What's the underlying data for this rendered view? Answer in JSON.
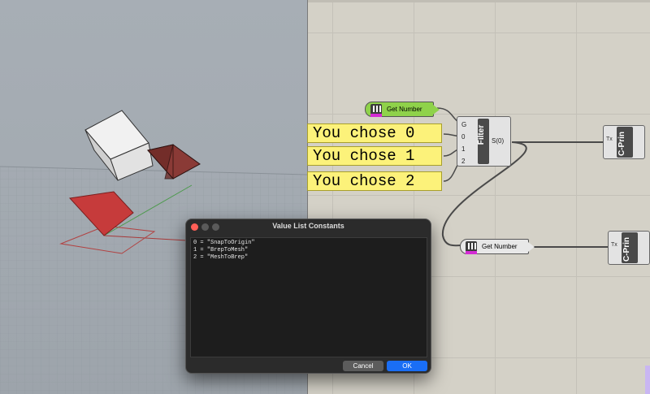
{
  "panels": [
    {
      "text": "You chose 0"
    },
    {
      "text": "You chose 1"
    },
    {
      "text": "You chose 2"
    }
  ],
  "get_number_top": {
    "label": "Get Number"
  },
  "get_number_bottom": {
    "label": "Get Number"
  },
  "filter": {
    "title": "Filter",
    "inputs": [
      "G",
      "0",
      "1",
      "2"
    ],
    "output": "S(0)"
  },
  "cprint_top": {
    "label": "C-Prin",
    "input": "Tx"
  },
  "cprint_bottom": {
    "label": "C-Prin",
    "input": "Tx"
  },
  "dialog": {
    "title": "Value List Constants",
    "lines": [
      "0 = \"SnapToOrigin\"",
      "1 = \"BrepToMesh\"",
      "2 = \"MeshToBrep\""
    ],
    "cancel_label": "Cancel",
    "ok_label": "OK"
  },
  "colors": {
    "panel_fill": "#fcf27a",
    "get_number_active": "#8fd24a",
    "ok_button": "#1a6ef5",
    "close_dot": "#ff5f57"
  }
}
